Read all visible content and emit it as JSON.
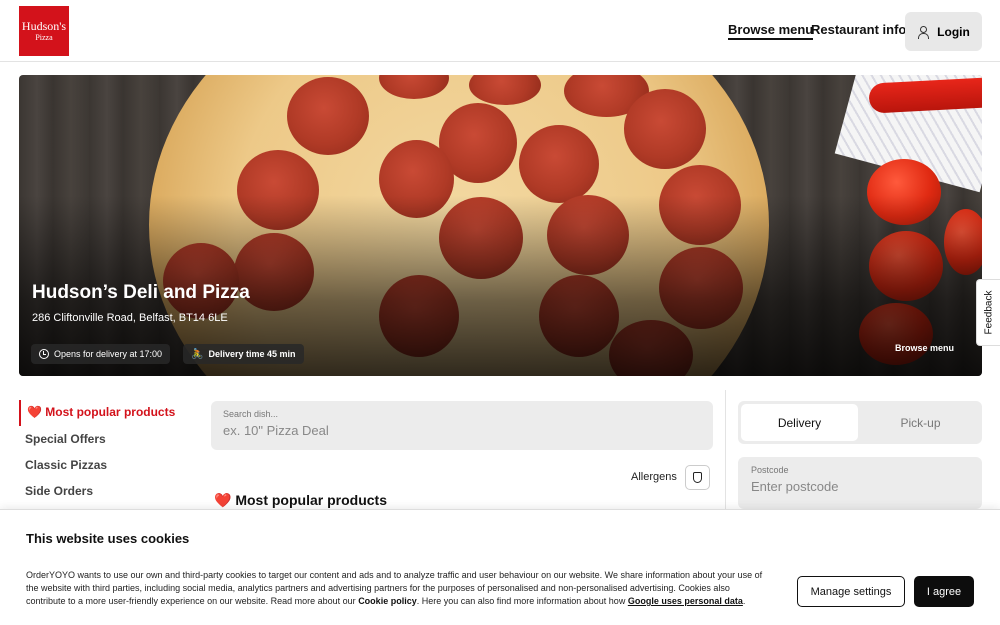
{
  "brand": {
    "logo_line1": "Hudson's",
    "logo_line2": "Pizza",
    "color": "#d3121b"
  },
  "nav": {
    "browse_menu": "Browse menu",
    "restaurant_info": "Restaurant info",
    "login": "Login"
  },
  "hero": {
    "title": "Hudson’s Deli and Pizza",
    "address": "286 Cliftonville Road, Belfast, BT14 6LE",
    "opens": "Opens for delivery at 17:00",
    "delivery_time": "Delivery time 45 min",
    "browse_menu": "Browse menu"
  },
  "feedback": "Feedback",
  "categories": {
    "active": "❤️ Most popular products",
    "items": [
      "Special Offers",
      "Classic Pizzas",
      "Side Orders"
    ]
  },
  "search": {
    "label": "Search dish...",
    "placeholder": "ex. 10\" Pizza Deal"
  },
  "allergens": "Allergens",
  "section_title": "❤️ Most popular products",
  "order": {
    "delivery": "Delivery",
    "pickup": "Pick-up",
    "postcode_label": "Postcode",
    "postcode_placeholder": "Enter postcode"
  },
  "cookie": {
    "title": "This website uses cookies",
    "text_part1": "OrderYOYO wants to use our own and third-party cookies to target our content and ads and to analyze traffic and user behaviour on our website. We share information about your use of the website with third parties, including social media, analytics partners and advertising partners for the purposes of personalised and non-personalised advertising. Cookies also contribute to a more user-friendly experience on our website. Read more about our ",
    "policy_link": "Cookie policy",
    "text_part2": ". Here you can also find more information about how ",
    "google_link": "Google uses personal data",
    "text_part3": ".",
    "manage": "Manage settings",
    "agree": "I agree"
  }
}
